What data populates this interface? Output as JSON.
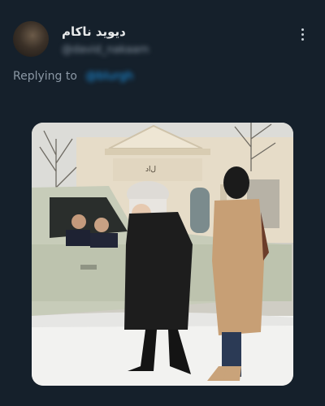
{
  "post": {
    "author_name": "دیوید ناکام",
    "author_handle": "@david_nakaam",
    "replying_label": "Replying to",
    "replying_handle": "@blurgh"
  },
  "icons": {
    "more": "more-vertical-icon",
    "avatar": "user-avatar"
  },
  "media": {
    "sign_text": "ل‌اد"
  },
  "colors": {
    "background": "#15202b",
    "link": "#1d9bf0",
    "secondary_text": "#8b98a5"
  }
}
